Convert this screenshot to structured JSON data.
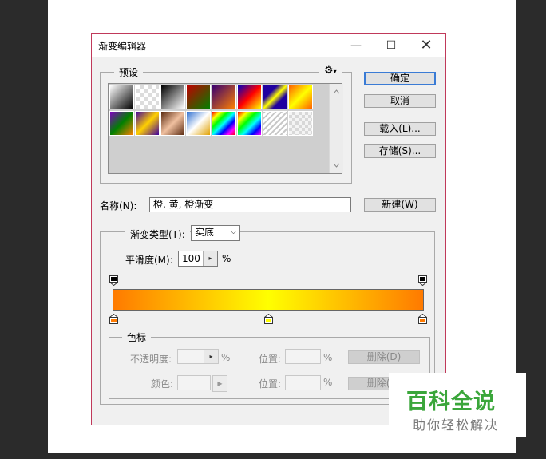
{
  "window": {
    "title": "渐变编辑器",
    "minimize": "—",
    "maximize": "☐",
    "close": "✕"
  },
  "presets": {
    "legend": "预设",
    "gear_icon": "⚙",
    "swatches": [
      "linear-gradient(135deg,#ffffff,#000000)",
      "repeating-conic-gradient(#dcdcdc 0 25%,#ffffff 0 50%) 0 0/10px 10px",
      "linear-gradient(135deg,#000000,#ffffff)",
      "linear-gradient(135deg,#c00000,#008000)",
      "linear-gradient(135deg,#3a0070,#ff8000)",
      "linear-gradient(135deg,#0000c0,#ff0000,#ffff00)",
      "linear-gradient(135deg,#2000a0 30%,#ffff00 50%,#2000a0 70%)",
      "linear-gradient(135deg,#ff6000,#ffff00,#ff6000)",
      "linear-gradient(135deg,#8000c0,#008000,#ff8000)",
      "linear-gradient(135deg,#4000a0,#ffd000,#4000a0)",
      "linear-gradient(135deg,#5a2a10,#f0c0a0,#5a2a10)",
      "linear-gradient(135deg,#3070d0,#ffffff,#e0a000)",
      "linear-gradient(135deg,#ff0000,#ffff00,#00ff00,#00ffff,#0000ff,#ff00ff,#ff0000)",
      "linear-gradient(135deg,#ff0000,#ffff00,#00ff00,#00ffff,#0000ff,#ff00ff)",
      "repeating-linear-gradient(135deg,#c8c8c8 0 2px,#ffffff 2px 5px)",
      "repeating-conic-gradient(#d8d8d8 0 25%,#f4f4f4 0 50%) 0 0/8px 8px"
    ]
  },
  "buttons": {
    "ok": "确定",
    "cancel": "取消",
    "load": "载入(L)...",
    "save": "存储(S)...",
    "new": "新建(W)"
  },
  "name": {
    "label": "名称(N):",
    "value": "橙, 黄, 橙渐变"
  },
  "gradient": {
    "type_label": "渐变类型(T):",
    "type_value": "实底",
    "smooth_label": "平滑度(M):",
    "smooth_value": "100",
    "smooth_unit": "%",
    "colors": {
      "orange": "#ff7a00",
      "yellow": "#ffff00"
    }
  },
  "stops": {
    "legend": "色标",
    "opacity_label": "不透明度:",
    "opacity_unit": "%",
    "location_label": "位置:",
    "location_unit": "%",
    "delete_label": "删除(D)",
    "color_label": "颜色:"
  },
  "watermark": {
    "main": "百科全说",
    "sub": "助你轻松解决"
  }
}
